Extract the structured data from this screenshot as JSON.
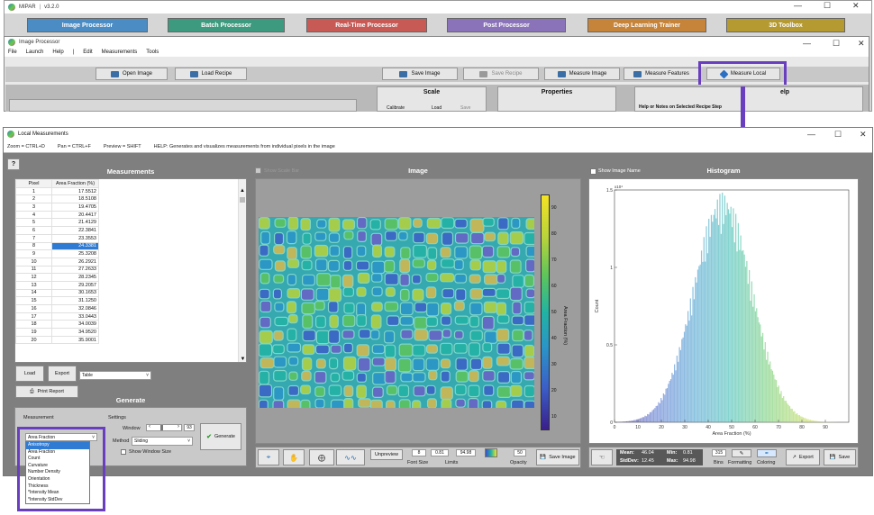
{
  "app": {
    "title": "MIPAR",
    "version": "v3.2.0"
  },
  "modules": [
    "Image Processor",
    "Batch Processor",
    "Real-Time Processor",
    "Post Processor",
    "Deep Learning Trainer",
    "3D Toolbox"
  ],
  "image_processor": {
    "title": "Image Processor",
    "menu": [
      "File",
      "Launch",
      "Help",
      "|",
      "Edit",
      "Measurements",
      "Tools"
    ],
    "toolbar": {
      "open_image": "Open Image",
      "load_recipe": "Load Recipe",
      "save_image": "Save Image",
      "save_recipe": "Save Recipe",
      "measure_image": "Measure Image",
      "measure_features": "Measure Features",
      "measure_local": "Measure Local"
    },
    "sections": {
      "scale": "Scale",
      "properties": "Properties",
      "help": "elp"
    },
    "scale_buttons": [
      "Calibrate",
      "Load",
      "Save"
    ],
    "notes_label": "Help or Notes on Selected Recipe Step"
  },
  "local": {
    "title": "Local Measurements",
    "help_items": [
      "Zoom = CTRL+D",
      "Pan = CTRL+F",
      "Preview = SHIFT",
      "HELP:  Generates and visualizes measurements from individual pixels in the image"
    ],
    "help_button": "?",
    "measurements": {
      "title": "Measurements",
      "columns": [
        "Pixel",
        "Area Fraction (%)"
      ],
      "rows": [
        [
          "1",
          "17.5512"
        ],
        [
          "2",
          "18.5108"
        ],
        [
          "3",
          "19.4705"
        ],
        [
          "4",
          "20.4417"
        ],
        [
          "5",
          "21.4129"
        ],
        [
          "6",
          "22.3841"
        ],
        [
          "7",
          "23.3553"
        ],
        [
          "8",
          "24.3381"
        ],
        [
          "9",
          "25.3208"
        ],
        [
          "10",
          "26.2921"
        ],
        [
          "11",
          "27.2633"
        ],
        [
          "12",
          "28.2345"
        ],
        [
          "13",
          "29.2057"
        ],
        [
          "14",
          "30.1653"
        ],
        [
          "15",
          "31.1250"
        ],
        [
          "16",
          "32.0846"
        ],
        [
          "17",
          "33.0443"
        ],
        [
          "18",
          "34.0039"
        ],
        [
          "19",
          "34.9520"
        ],
        [
          "20",
          "35.9001"
        ]
      ],
      "selected_row": 8,
      "load": "Load",
      "export": "Export",
      "export_format": "Table",
      "print_report": "Print Report"
    },
    "generate": {
      "title": "Generate",
      "measurement_label": "Measurement",
      "measurement_value": "Area Fraction",
      "options": [
        "Anisotropy",
        "Area Fraction",
        "Count",
        "Curvature",
        "Number Density",
        "Orientation",
        "Thickness",
        "*Intensity Mean",
        "*Intensity StdDev"
      ],
      "highlighted_option": "Anisotropy",
      "settings_label": "Settings",
      "window_label": "Window",
      "window_value": "93",
      "method_label": "Method",
      "method_value": "Sliding",
      "show_window_size": "Show Window Size",
      "generate_button": "Generate"
    },
    "image": {
      "title": "Image",
      "show_scale_bar": "Show Scale Bar",
      "colorbar_label": "Area Fraction (%)",
      "colorbar_ticks": [
        "90",
        "80",
        "70",
        "60",
        "50",
        "40",
        "30",
        "20",
        "10"
      ],
      "unpreview": "Unpreview",
      "font_size_label": "Font Size",
      "font_size_value": "8",
      "limits_label": "Limits",
      "limit_min": "0.81",
      "limit_max": "94.98",
      "opacity_label": "Opacity",
      "opacity_value": "50",
      "save_image": "Save Image"
    },
    "histogram": {
      "title": "Histogram",
      "show_image_name": "Show Image Name",
      "exponent": "x10⁴",
      "y_label": "Count",
      "x_label": "Area Fraction (%)",
      "y_ticks": [
        "1.5",
        "1",
        "0.5",
        "0"
      ],
      "x_ticks": [
        "0",
        "10",
        "20",
        "30",
        "40",
        "50",
        "60",
        "70",
        "80",
        "90"
      ],
      "stats": {
        "mean_label": "Mean:",
        "mean": "46.04",
        "min_label": "Min:",
        "min": "0.81",
        "stddev_label": "StdDev:",
        "stddev": "12.45",
        "max_label": "Max:",
        "max": "94.98"
      },
      "bins_value": "315",
      "bins_label": "Bins",
      "formatting_label": "Formatting",
      "coloring_label": "Coloring",
      "export": "Export",
      "save": "Save"
    }
  },
  "colors": {
    "highlight": "#6a3fbf",
    "selection": "#2f7bd3"
  }
}
